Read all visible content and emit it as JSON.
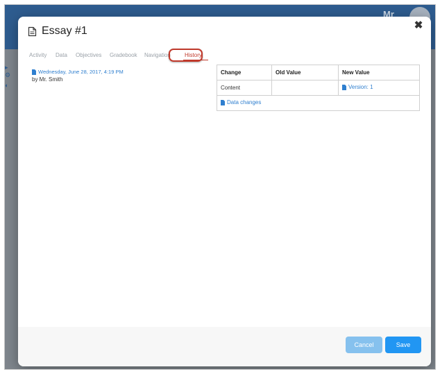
{
  "background": {
    "avatar_text": "Mr"
  },
  "modal": {
    "title": "Essay #1"
  },
  "tabs": [
    "Activity",
    "Data",
    "Objectives",
    "Gradebook",
    "Navigation",
    "History"
  ],
  "active_tab": "History",
  "history_entry": {
    "date": "Wednesday, June 28, 2017, 4:19 PM",
    "author": "by Mr. Smith"
  },
  "changes_table": {
    "headers": [
      "Change",
      "Old Value",
      "New Value"
    ],
    "rows": [
      {
        "change": "Content",
        "old_value": "",
        "new_value": "Version: 1"
      }
    ],
    "footer_link": "Data changes"
  },
  "buttons": {
    "cancel": "Cancel",
    "save": "Save"
  },
  "colors": {
    "accent": "#2196f3",
    "tab_active": "#c0392b",
    "link": "#2f7fcf"
  }
}
